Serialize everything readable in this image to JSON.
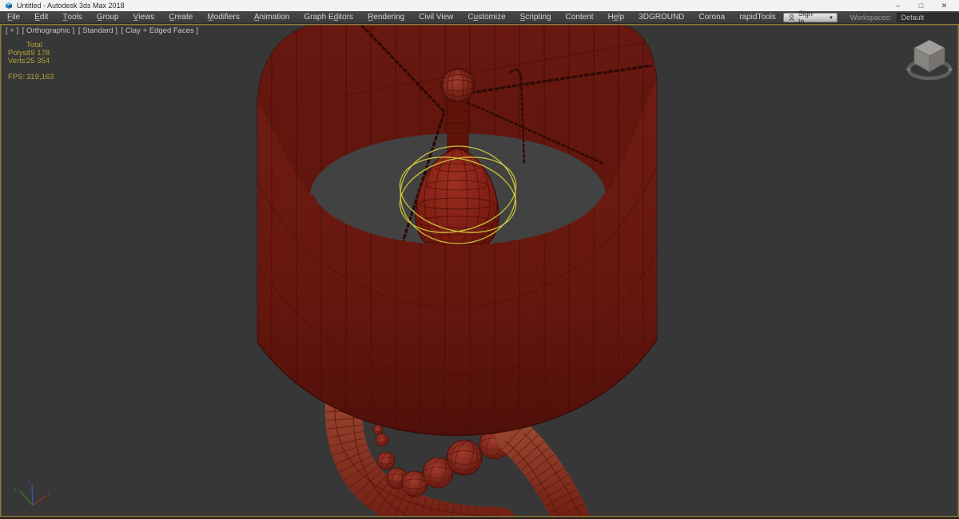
{
  "window": {
    "title": "Untitled - Autodesk 3ds Max 2018",
    "minimize": "–",
    "maximize": "□",
    "close": "✕"
  },
  "menu": {
    "items": [
      "F̲ile",
      "E̲dit",
      "T̲ools",
      "G̲roup",
      "V̲iews",
      "C̲reate",
      "M̲odifiers",
      "A̲nimation",
      "Graph Ed̲itors",
      "R̲endering",
      "Civil View",
      "Cu̲stomize",
      "S̲cripting",
      "Content",
      "He̲lp",
      "3DGROUND",
      "Corona",
      "rapidTools"
    ]
  },
  "account": {
    "sign_in": "Sign In",
    "caret": "▾",
    "workspaces_label": "Workspaces:",
    "workspace_value": "Default"
  },
  "viewport": {
    "label": {
      "plus": "[ + ]",
      "view": "[ Orthographic ]",
      "style": "[ Standard ]",
      "shading": "[ Clay + Edged Faces ]"
    },
    "stats": {
      "header": "Total",
      "polys_label": "Polys:",
      "polys_value": "49 178",
      "verts_label": "Verts:",
      "verts_value": "25 354",
      "fps_label": "FPS:",
      "fps_value": "319,163"
    },
    "axis": {
      "x": "x",
      "y": "y",
      "z": "z"
    },
    "colors": {
      "viewport_bg": "#373737",
      "model_red": "#6c1a12",
      "gizmo_yellow": "#cdc93c",
      "active_border": "#8d783a",
      "stats_text": "#b1a239"
    }
  }
}
